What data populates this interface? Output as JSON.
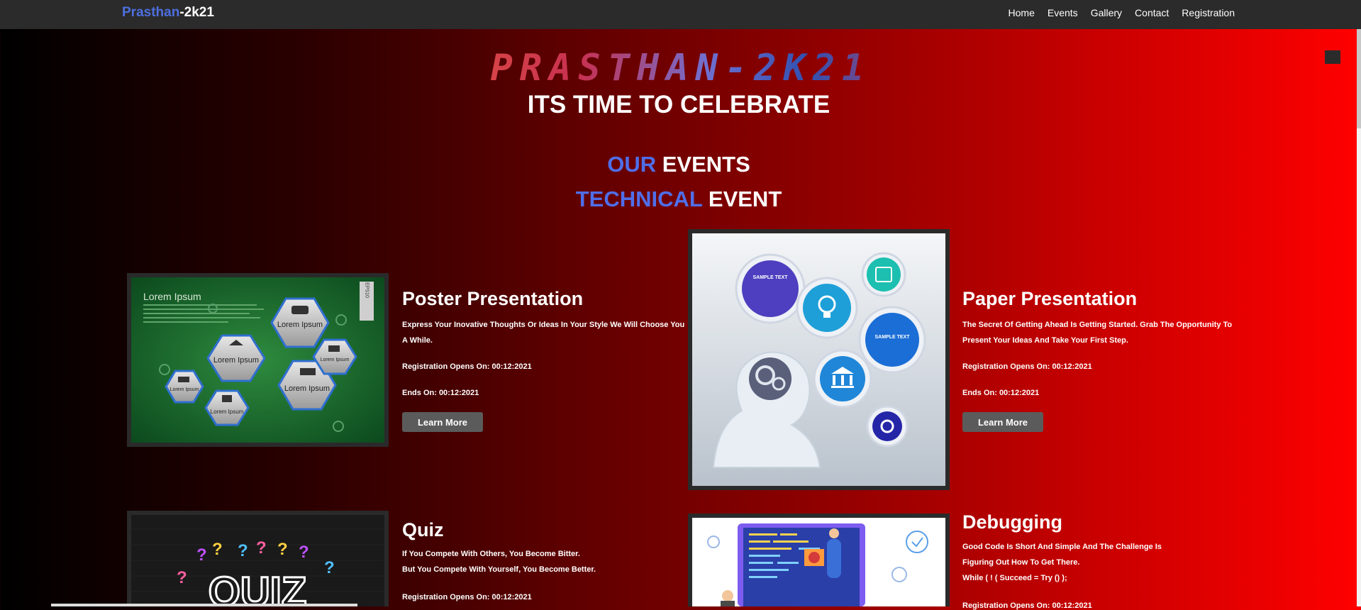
{
  "nav": {
    "brand_part1": "Prasthan",
    "brand_part2": "-2k21",
    "links": [
      "Home",
      "Events",
      "Gallery",
      "Contact",
      "Registration"
    ]
  },
  "hero": {
    "logo_text": "PRASTHAN-2K21",
    "tagline": "ITS TIME TO CELEBRATE"
  },
  "section": {
    "our": "OUR",
    "events": "EVENTS",
    "technical": "TECHNICAL",
    "event": "EVENT"
  },
  "events": [
    {
      "title": "Poster Presentation",
      "desc_line1": "Express Your Inovative Thoughts Or Ideas In Your Style We Will Choose You",
      "desc_line2": "A While.",
      "reg_opens": "Registration Opens On: 00:12:2021",
      "ends": "Ends On: 00:12:2021",
      "button": "Learn More"
    },
    {
      "title": "Paper Presentation",
      "desc_line1": "The Secret Of Getting Ahead Is Getting Started. Grab The Opportunity To",
      "desc_line2": "Present Your Ideas And Take Your First Step.",
      "reg_opens": "Registration Opens On: 00:12:2021",
      "ends": "Ends On: 00:12:2021",
      "button": "Learn More"
    },
    {
      "title": "Quiz",
      "desc_line1": "If You Compete With Others, You Become Bitter.",
      "desc_line2": "But You Compete With Yourself, You Become Better.",
      "reg_opens": "Registration Opens On: 00:12:2021"
    },
    {
      "title": "Debugging",
      "desc_line1": "Good Code Is Short And Simple And The Challenge Is",
      "desc_line2": "Figuring Out How To Get There.",
      "desc_line3": "While ( ! ( Succeed = Try () );",
      "reg_opens": "Registration Opens On: 00:12:2021"
    }
  ],
  "images": {
    "poster": {
      "heading": "Lorem Ipsum",
      "hex_label": "Lorem Ipsum",
      "badge": "EPS10"
    },
    "paper": {
      "sample_text": "SAMPLE TEXT"
    },
    "quiz": {
      "word": "QUIZ"
    }
  },
  "colors": {
    "accent_blue": "#4f6ee8",
    "navbar": "#2b2b2b",
    "button": "#5b5b5b"
  }
}
